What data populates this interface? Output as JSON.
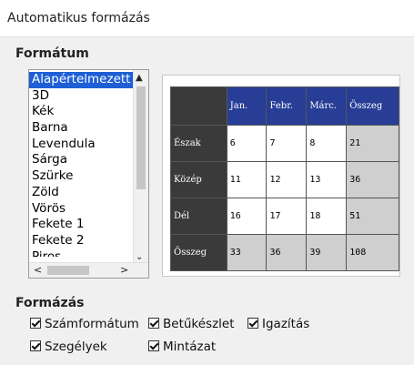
{
  "window": {
    "title": "Automatikus formázás"
  },
  "format_section": {
    "label": "Formátum"
  },
  "list": {
    "items": [
      "Alapértelmezett st",
      "3D",
      "Kék",
      "Barna",
      "Levendula",
      "Sárga",
      "Szürke",
      "Zöld",
      "Vörös",
      "Fekete 1",
      "Fekete 2",
      "Piros"
    ],
    "selected_index": 0
  },
  "preview": {
    "columns": [
      "",
      "Jan.",
      "Febr.",
      "Márc.",
      "Összeg"
    ],
    "rows": [
      {
        "label": "Észak",
        "values": [
          "6",
          "7",
          "8",
          "21"
        ]
      },
      {
        "label": "Közép",
        "values": [
          "11",
          "12",
          "13",
          "36"
        ]
      },
      {
        "label": "Dél",
        "values": [
          "16",
          "17",
          "18",
          "51"
        ]
      },
      {
        "label": "Összeg",
        "values": [
          "33",
          "36",
          "39",
          "108"
        ]
      }
    ],
    "colors": {
      "header": "#273d96",
      "row_header": "#3a3a3a",
      "total_cell": "#cfcfcf"
    }
  },
  "formatting_section": {
    "label": "Formázás"
  },
  "checkboxes": {
    "number_format": {
      "label": "Számformátum",
      "checked": true
    },
    "font": {
      "label": "Betűkészlet",
      "checked": true
    },
    "alignment": {
      "label": "Igazítás",
      "checked": true
    },
    "borders": {
      "label": "Szegélyek",
      "checked": true
    },
    "pattern": {
      "label": "Mintázat",
      "checked": true
    }
  }
}
